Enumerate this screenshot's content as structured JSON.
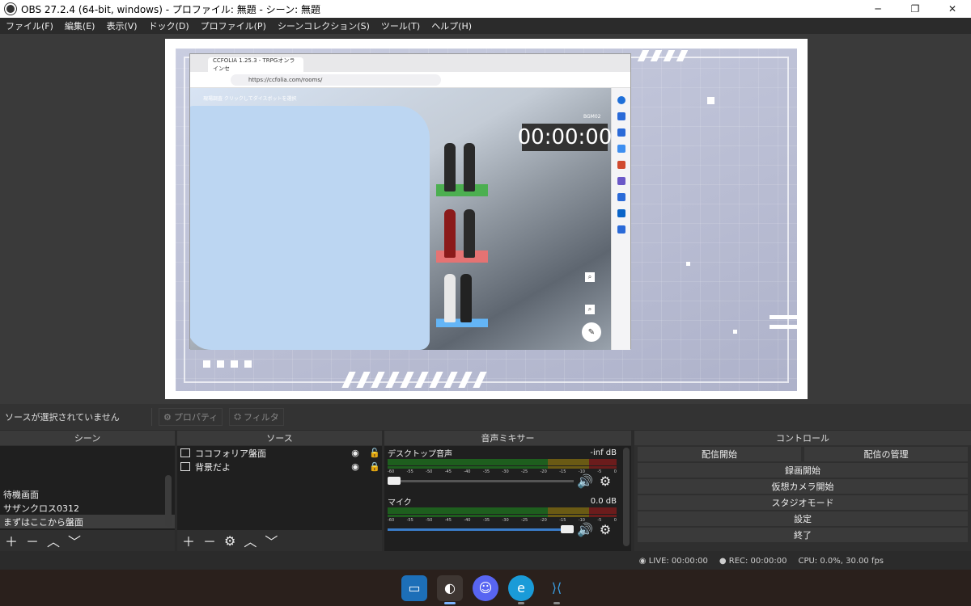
{
  "window": {
    "title": "OBS 27.2.4 (64-bit, windows) - プロファイル: 無題 - シーン: 無題",
    "minimize": "─",
    "restore": "❐",
    "close": "✕"
  },
  "menu": [
    "ファイル(F)",
    "編集(E)",
    "表示(V)",
    "ドック(D)",
    "プロファイル(P)",
    "シーンコレクション(S)",
    "ツール(T)",
    "ヘルプ(H)"
  ],
  "preview": {
    "browser_tab": "CCFOLIA 1.25.3 - TRPGオンラインセ",
    "url": "https://ccfolia.com/rooms/",
    "ccfolia_toolbar_text": "現場調査 クリックしてダイスボットを選択",
    "bgm_label": "BGM02",
    "timer": "00:00:00"
  },
  "status_bar": {
    "no_source": "ソースが選択されていません",
    "properties": "プロパティ",
    "filters": "フィルタ"
  },
  "scenes": {
    "title": "シーン",
    "items": [
      "待機画面",
      "サザンクロス0312",
      "まずはここから盤面"
    ],
    "selected_index": 2
  },
  "sources": {
    "title": "ソース",
    "items": [
      {
        "name": "ココフォリア盤面",
        "visible": true,
        "locked": false
      },
      {
        "name": "背景だよ",
        "visible": true,
        "locked": true
      }
    ]
  },
  "mixer": {
    "title": "音声ミキサー",
    "ticks": [
      "-60",
      "-55",
      "-50",
      "-45",
      "-40",
      "-35",
      "-30",
      "-25",
      "-20",
      "-15",
      "-10",
      "-5",
      "0"
    ],
    "channels": [
      {
        "name": "デスクトップ音声",
        "level": "-inf dB",
        "volume": 0.0
      },
      {
        "name": "マイク",
        "level": "0.0 dB",
        "volume": 1.0
      }
    ]
  },
  "controls": {
    "title": "コントロール",
    "start_stream": "配信開始",
    "manage_stream": "配信の管理",
    "start_recording": "録画開始",
    "virtual_camera": "仮想カメラ開始",
    "studio_mode": "スタジオモード",
    "settings": "設定",
    "exit": "終了"
  },
  "footer": {
    "live": "LIVE: 00:00:00",
    "rec": "REC: 00:00:00",
    "cpu": "CPU: 0.0%, 30.00 fps"
  },
  "taskbar": [
    "screen-capture-icon",
    "obs-icon",
    "discord-icon",
    "edge-icon",
    "vscode-icon"
  ],
  "colors": {
    "accent": "#3a7cc8",
    "panel": "#2f2f2f",
    "list_bg": "#1f1f1f"
  }
}
